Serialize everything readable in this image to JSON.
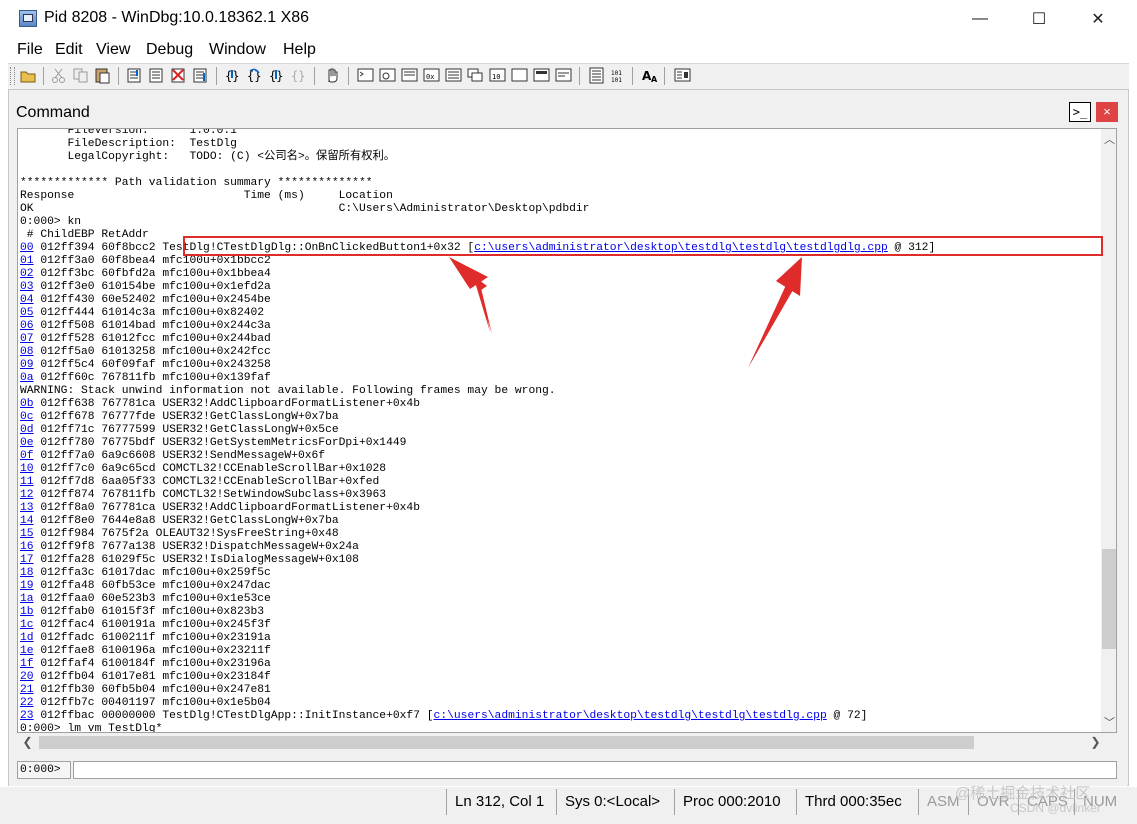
{
  "window": {
    "title": "Pid 8208 - WinDbg:10.0.18362.1 X86",
    "controls": {
      "minimize": "—",
      "maximize": "☐",
      "close": "✕"
    }
  },
  "menu": [
    "File",
    "Edit",
    "View",
    "Debug",
    "Window",
    "Help"
  ],
  "command_window": {
    "title": "Command",
    "icon_label": ">_",
    "close_label": "×",
    "lines": [
      {
        "text": "       FileVersion:      1.0.0.1"
      },
      {
        "text": "       FileDescription:  TestDlg"
      },
      {
        "text": "       LegalCopyright:   TODO: (C) <公司名>。保留所有权利。"
      },
      {
        "text": ""
      },
      {
        "text": "************* Path validation summary **************"
      },
      {
        "text": "Response                         Time (ms)     Location"
      },
      {
        "text": "OK                                             C:\\Users\\Administrator\\Desktop\\pdbdir"
      },
      {
        "text": "0:000> kn"
      },
      {
        "text": " # ChildEBP RetAddr"
      },
      {
        "frame": "00",
        "text": " 012ff394 60f8bcc2 TestDlg!CTestDlgDlg::OnBnClickedButton1+0x32 [",
        "link": "c:\\users\\administrator\\desktop\\testdlg\\testdlg\\testdlgdlg.cpp",
        "tail": " @ 312]"
      },
      {
        "frame": "01",
        "text": " 012ff3a0 60f8bea4 mfc100u+0x1bbcc2"
      },
      {
        "frame": "02",
        "text": " 012ff3bc 60fbfd2a mfc100u+0x1bbea4"
      },
      {
        "frame": "03",
        "text": " 012ff3e0 610154be mfc100u+0x1efd2a"
      },
      {
        "frame": "04",
        "text": " 012ff430 60e52402 mfc100u+0x2454be"
      },
      {
        "frame": "05",
        "text": " 012ff444 61014c3a mfc100u+0x82402"
      },
      {
        "frame": "06",
        "text": " 012ff508 61014bad mfc100u+0x244c3a"
      },
      {
        "frame": "07",
        "text": " 012ff528 61012fcc mfc100u+0x244bad"
      },
      {
        "frame": "08",
        "text": " 012ff5a0 61013258 mfc100u+0x242fcc"
      },
      {
        "frame": "09",
        "text": " 012ff5c4 60f09faf mfc100u+0x243258"
      },
      {
        "frame": "0a",
        "text": " 012ff60c 767811fb mfc100u+0x139faf"
      },
      {
        "text": "WARNING: Stack unwind information not available. Following frames may be wrong."
      },
      {
        "frame": "0b",
        "text": " 012ff638 767781ca USER32!AddClipboardFormatListener+0x4b"
      },
      {
        "frame": "0c",
        "text": " 012ff678 76777fde USER32!GetClassLongW+0x7ba"
      },
      {
        "frame": "0d",
        "text": " 012ff71c 76777599 USER32!GetClassLongW+0x5ce"
      },
      {
        "frame": "0e",
        "text": " 012ff780 76775bdf USER32!GetSystemMetricsForDpi+0x1449"
      },
      {
        "frame": "0f",
        "text": " 012ff7a0 6a9c6608 USER32!SendMessageW+0x6f"
      },
      {
        "frame": "10",
        "text": " 012ff7c0 6a9c65cd COMCTL32!CCEnableScrollBar+0x1028"
      },
      {
        "frame": "11",
        "text": " 012ff7d8 6aa05f33 COMCTL32!CCEnableScrollBar+0xfed"
      },
      {
        "frame": "12",
        "text": " 012ff874 767811fb COMCTL32!SetWindowSubclass+0x3963"
      },
      {
        "frame": "13",
        "text": " 012ff8a0 767781ca USER32!AddClipboardFormatListener+0x4b"
      },
      {
        "frame": "14",
        "text": " 012ff8e0 7644e8a8 USER32!GetClassLongW+0x7ba"
      },
      {
        "frame": "15",
        "text": " 012ff984 7675f2a OLEAUT32!SysFreeString+0x48"
      },
      {
        "frame": "16",
        "text": " 012ff9f8 7677a138 USER32!DispatchMessageW+0x24a"
      },
      {
        "frame": "17",
        "text": " 012ffa28 61029f5c USER32!IsDialogMessageW+0x108"
      },
      {
        "frame": "18",
        "text": " 012ffa3c 61017dac mfc100u+0x259f5c"
      },
      {
        "frame": "19",
        "text": " 012ffa48 60fb53ce mfc100u+0x247dac"
      },
      {
        "frame": "1a",
        "text": " 012ffaa0 60e523b3 mfc100u+0x1e53ce"
      },
      {
        "frame": "1b",
        "text": " 012ffab0 61015f3f mfc100u+0x823b3"
      },
      {
        "frame": "1c",
        "text": " 012ffac4 6100191a mfc100u+0x245f3f"
      },
      {
        "frame": "1d",
        "text": " 012ffadc 6100211f mfc100u+0x23191a"
      },
      {
        "frame": "1e",
        "text": " 012ffae8 6100196a mfc100u+0x23211f"
      },
      {
        "frame": "1f",
        "text": " 012ffaf4 6100184f mfc100u+0x23196a"
      },
      {
        "frame": "20",
        "text": " 012ffb04 61017e81 mfc100u+0x23184f"
      },
      {
        "frame": "21",
        "text": " 012ffb30 60fb5b04 mfc100u+0x247e81"
      },
      {
        "frame": "22",
        "text": " 012ffb7c 00401197 mfc100u+0x1e5b04"
      },
      {
        "frame": "23",
        "text": " 012ffbac 00000000 TestDlg!CTestDlgApp::InitInstance+0xf7 [",
        "link": "c:\\users\\administrator\\desktop\\testdlg\\testdlg\\testdlg.cpp",
        "tail": " @ 72]"
      },
      {
        "text": "0:000> lm vm TestDlg*"
      }
    ],
    "prompt_label": "0:000>",
    "input_value": ""
  },
  "statusbar": {
    "cells": [
      "Ln 312, Col 1",
      "Sys 0:<Local>",
      "Proc 000:2010",
      "Thrd 000:35ec",
      "ASM",
      "OVR",
      "CAPS",
      "NUM"
    ]
  },
  "watermark": {
    "line1": "@稀土掘金技术社区",
    "line2": "CSDN @dvlinker"
  },
  "colors": {
    "highlight": "#e02b2b",
    "link": "#0000ee"
  }
}
